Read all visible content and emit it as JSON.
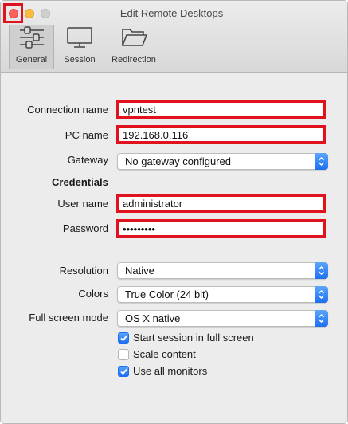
{
  "window": {
    "title": "Edit Remote Desktops -"
  },
  "toolbar": {
    "tabs": [
      {
        "label": "General",
        "icon": "sliders-icon",
        "active": true
      },
      {
        "label": "Session",
        "icon": "monitor-icon",
        "active": false
      },
      {
        "label": "Redirection",
        "icon": "folder-icon",
        "active": false
      }
    ]
  },
  "form": {
    "connection_name": {
      "label": "Connection name",
      "value": "vpntest"
    },
    "pc_name": {
      "label": "PC name",
      "value": "192.168.0.116"
    },
    "gateway": {
      "label": "Gateway",
      "value": "No gateway configured"
    },
    "credentials_heading": "Credentials",
    "user_name": {
      "label": "User name",
      "value": "administrator"
    },
    "password": {
      "label": "Password",
      "value": "•••••••••"
    },
    "resolution": {
      "label": "Resolution",
      "value": "Native"
    },
    "colors": {
      "label": "Colors",
      "value": "True Color (24 bit)"
    },
    "full_screen_mode": {
      "label": "Full screen mode",
      "value": "OS X native"
    },
    "checkboxes": [
      {
        "label": "Start session in full screen",
        "checked": true
      },
      {
        "label": "Scale content",
        "checked": false
      },
      {
        "label": "Use all monitors",
        "checked": true
      }
    ]
  },
  "colors": {
    "highlight_red": "#e0121e",
    "accent_blue": "#1d6ff2"
  }
}
